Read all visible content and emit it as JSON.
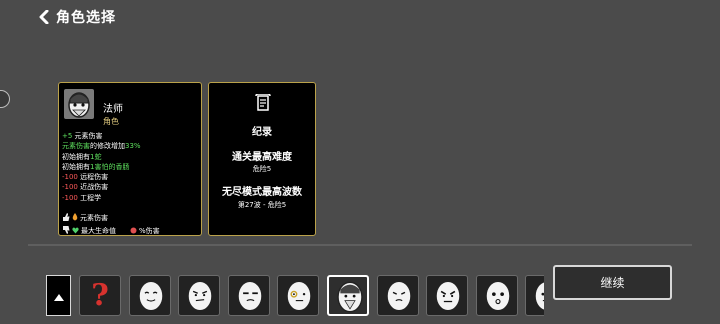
{
  "header": {
    "title": "角色选择",
    "back_icon": "chevron-left-icon"
  },
  "character_card": {
    "name": "法师",
    "type": "角色",
    "stats": [
      {
        "parts": [
          {
            "text": "+5",
            "color": "green"
          },
          {
            "text": " 元素伤害",
            "color": "white"
          }
        ]
      },
      {
        "parts": [
          {
            "text": "元素伤害",
            "color": "green"
          },
          {
            "text": "的修改增加",
            "color": "white"
          },
          {
            "text": "33%",
            "color": "green"
          }
        ]
      },
      {
        "parts": [
          {
            "text": "初始拥有",
            "color": "white"
          },
          {
            "text": "1蛇",
            "color": "green"
          }
        ]
      },
      {
        "parts": [
          {
            "text": "初始拥有",
            "color": "white"
          },
          {
            "text": "1害怕的香肠",
            "color": "green"
          }
        ]
      },
      {
        "parts": [
          {
            "text": "-100",
            "color": "red"
          },
          {
            "text": " 远程伤害",
            "color": "white"
          }
        ]
      },
      {
        "parts": [
          {
            "text": "-100",
            "color": "red"
          },
          {
            "text": " 近战伤害",
            "color": "white"
          }
        ]
      },
      {
        "parts": [
          {
            "text": "-100",
            "color": "red"
          },
          {
            "text": " 工程学",
            "color": "white"
          }
        ]
      }
    ],
    "tags_row1": [
      "元素伤害"
    ],
    "tags_row2": [
      "最大生命值",
      "%伤害"
    ]
  },
  "record_card": {
    "title": "纪录",
    "difficulty_heading": "通关最高难度",
    "difficulty_value": "危险5",
    "endless_heading": "无尽模式最高波数",
    "endless_value": "第27波 - 危险5"
  },
  "character_slots": [
    {
      "id": "random",
      "face": "question",
      "selected": false
    },
    {
      "id": "c1",
      "face": "smile",
      "selected": false
    },
    {
      "id": "c2",
      "face": "smirk",
      "selected": false
    },
    {
      "id": "c3",
      "face": "smug",
      "selected": false
    },
    {
      "id": "c4",
      "face": "monocle",
      "selected": false
    },
    {
      "id": "c5",
      "face": "mage",
      "selected": true
    },
    {
      "id": "c6",
      "face": "annoyed",
      "selected": false
    },
    {
      "id": "c7",
      "face": "grumpy",
      "selected": false
    },
    {
      "id": "c8",
      "face": "surprised",
      "selected": false
    },
    {
      "id": "c9",
      "face": "partial",
      "selected": false
    }
  ],
  "continue_label": "继续",
  "colors": {
    "green": "#5ee05e",
    "red": "#ff5a5a",
    "gold_border": "#bba24a",
    "background": "#4b4b4b"
  }
}
